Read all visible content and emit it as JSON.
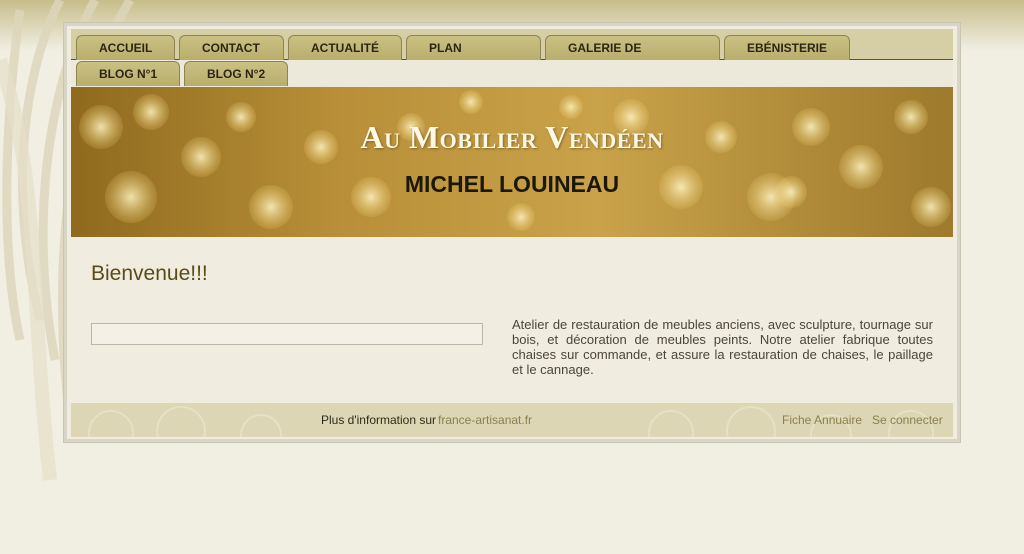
{
  "nav": {
    "row1": [
      {
        "label": "ACCUEIL"
      },
      {
        "label": "CONTACT"
      },
      {
        "label": "ACTUALITÉ"
      },
      {
        "label": "PLAN"
      },
      {
        "label": "GALERIE DE"
      },
      {
        "label": "EBÉNISTERIE"
      }
    ],
    "row2": [
      {
        "label": "BLOG N°1"
      },
      {
        "label": "BLOG N°2"
      }
    ]
  },
  "banner": {
    "title": "Au Mobilier Vendéen",
    "subtitle": "MICHEL LOUINEAU"
  },
  "content": {
    "heading": "Bienvenue!!!",
    "description": "Atelier de restauration de meubles anciens, avec sculpture, tournage sur bois, et décoration de meubles peints. Notre atelier fabrique toutes chaises sur commande, et assure la restauration de chaises, le paillage et le cannage."
  },
  "footer": {
    "more_info": "Plus d'information sur",
    "site_link": "france-artisanat.fr",
    "fiche": "Fiche Annuaire",
    "login": "Se connecter"
  },
  "colors": {
    "background": "#f1eee2",
    "tab": "#c3b979",
    "heading": "#5a4c16",
    "link": "#8a7f4e"
  }
}
